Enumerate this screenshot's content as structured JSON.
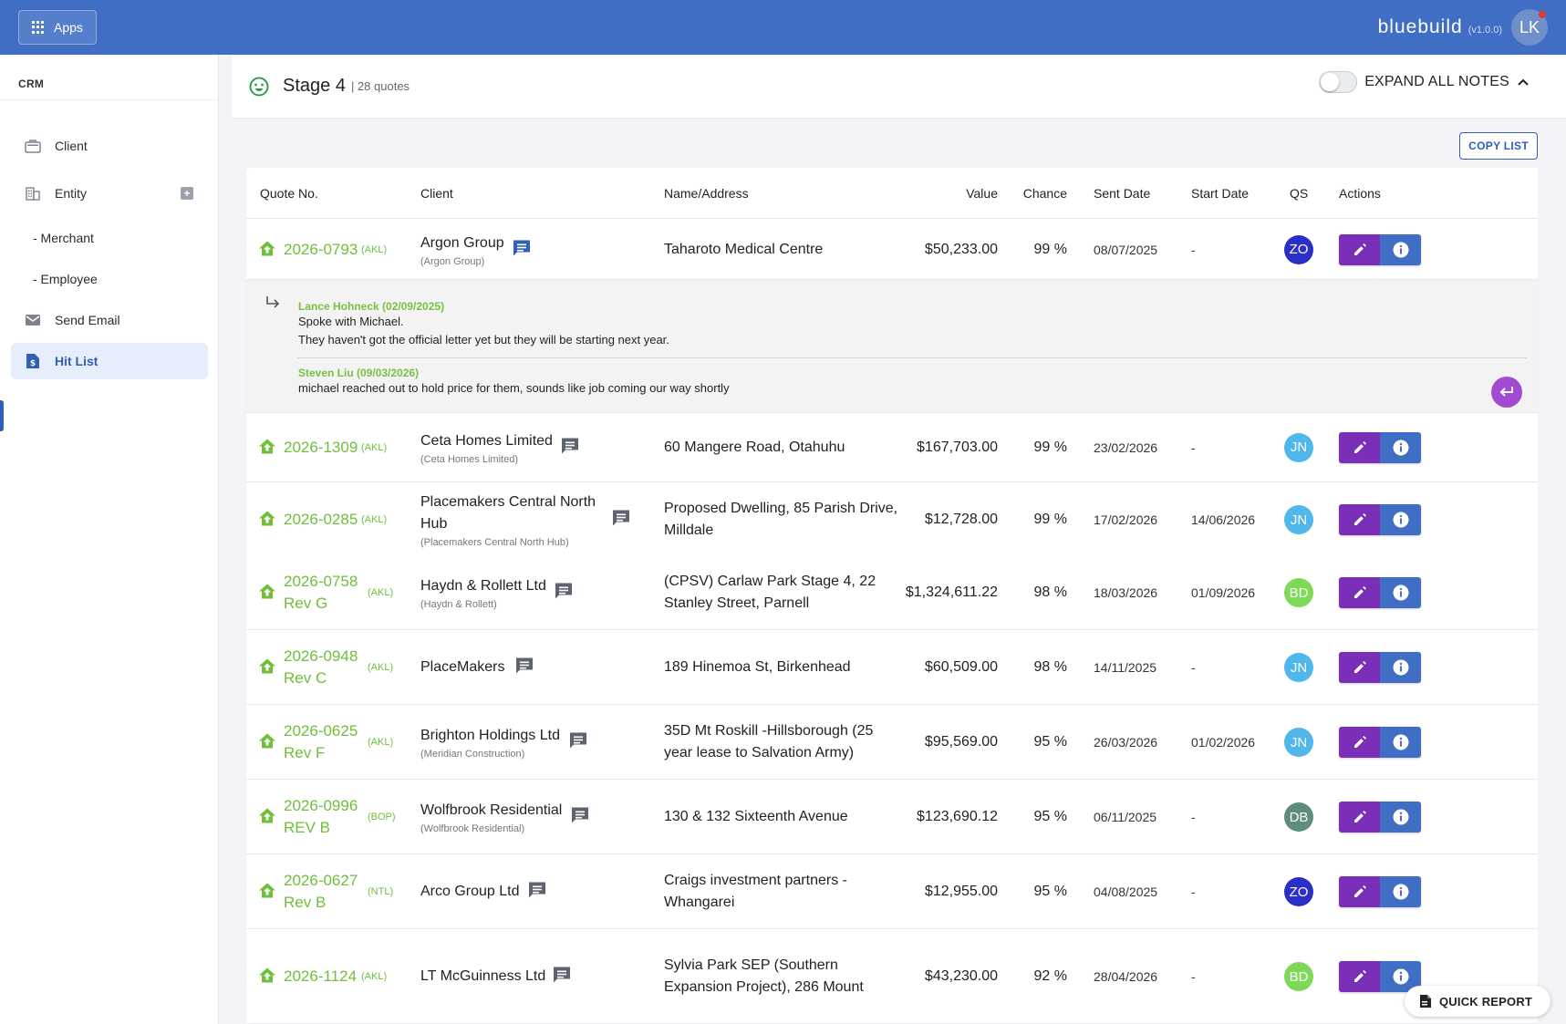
{
  "topbar": {
    "apps_label": "Apps",
    "brand": "bluebuild",
    "version": "(v1.0.0)",
    "user_initials": "LK"
  },
  "sidebar": {
    "section": "CRM",
    "items": [
      {
        "label": "Client",
        "icon": "briefcase-icon"
      },
      {
        "label": "Entity",
        "icon": "building-icon"
      },
      {
        "label": "- Merchant"
      },
      {
        "label": "- Employee"
      },
      {
        "label": "Send Email",
        "icon": "mail-icon"
      },
      {
        "label": "Hit List",
        "icon": "document-dollar-icon",
        "active": true
      }
    ]
  },
  "stage": {
    "title": "Stage 4",
    "count": "| 28 quotes",
    "expand_label": "EXPAND ALL NOTES",
    "expand_on": false,
    "copy_label": "COPY LIST"
  },
  "table": {
    "headers": {
      "quote": "Quote No.",
      "client": "Client",
      "name": "Name/Address",
      "value": "Value",
      "chance": "Chance",
      "sent": "Sent Date",
      "start": "Start Date",
      "qs": "QS",
      "actions": "Actions"
    },
    "rows": [
      {
        "quote": "2026-0793",
        "quote2": "",
        "region": "(AKL)",
        "client": "Argon Group",
        "client2": "",
        "client_sub": "(Argon Group)",
        "name": "Taharoto Medical Centre",
        "name2": "",
        "value": "$50,233.00",
        "chance": "99 %",
        "sent": "08/07/2025",
        "start": "-",
        "qs": "ZO",
        "qs_color": "#2a2fc8"
      },
      {
        "quote": "2026-1309",
        "quote2": "",
        "region": "(AKL)",
        "client": "Ceta Homes Limited",
        "client2": "",
        "client_sub": "(Ceta Homes Limited)",
        "name": "60 Mangere Road, Otahuhu",
        "name2": "",
        "value": "$167,703.00",
        "chance": "99 %",
        "sent": "23/02/2026",
        "start": "-",
        "qs": "JN",
        "qs_color": "#4fb7ea"
      },
      {
        "quote": "2026-0285",
        "quote2": "",
        "region": "(AKL)",
        "client": "Placemakers Central North",
        "client2": "Hub",
        "client_sub": "(Placemakers Central North Hub)",
        "name": "Proposed Dwelling, 85 Parish Drive,",
        "name2": "Milldale",
        "value": "$12,728.00",
        "chance": "99 %",
        "sent": "17/02/2026",
        "start": "14/06/2026",
        "qs": "JN",
        "qs_color": "#4fb7ea"
      },
      {
        "quote": "2026-0758",
        "quote2": "Rev G",
        "region": "(AKL)",
        "client": "Haydn & Rollett Ltd",
        "client2": "",
        "client_sub": "(Haydn & Rollett)",
        "name": "(CPSV) Carlaw Park Stage 4, 22",
        "name2": "Stanley Street, Parnell",
        "value": "$1,324,611.22",
        "chance": "98 %",
        "sent": "18/03/2026",
        "start": "01/09/2026",
        "qs": "BD",
        "qs_color": "#7ed957"
      },
      {
        "quote": "2026-0948",
        "quote2": "Rev C",
        "region": "(AKL)",
        "client": "PlaceMakers",
        "client2": "",
        "client_sub": "",
        "name": "189 Hinemoa St, Birkenhead",
        "name2": "",
        "value": "$60,509.00",
        "chance": "98 %",
        "sent": "14/11/2025",
        "start": "-",
        "qs": "JN",
        "qs_color": "#4fb7ea"
      },
      {
        "quote": "2026-0625",
        "quote2": "Rev F",
        "region": "(AKL)",
        "client": "Brighton Holdings Ltd",
        "client2": "",
        "client_sub": "(Meridian Construction)",
        "name": "35D Mt Roskill -Hillsborough (25",
        "name2": "year lease to Salvation Army)",
        "value": "$95,569.00",
        "chance": "95 %",
        "sent": "26/03/2026",
        "start": "01/02/2026",
        "qs": "JN",
        "qs_color": "#4fb7ea"
      },
      {
        "quote": "2026-0996",
        "quote2": "REV B",
        "region": "(BOP)",
        "client": "Wolfbrook Residential",
        "client2": "",
        "client_sub": "(Wolfbrook Residential)",
        "name": "130 & 132 Sixteenth Avenue",
        "name2": "",
        "value": "$123,690.12",
        "chance": "95 %",
        "sent": "06/11/2025",
        "start": "-",
        "qs": "DB",
        "qs_color": "#5e8c7e"
      },
      {
        "quote": "2026-0627",
        "quote2": "Rev B",
        "region": "(NTL)",
        "client": "Arco Group Ltd",
        "client2": "",
        "client_sub": "",
        "name": "Craigs investment partners -",
        "name2": "Whangarei",
        "value": "$12,955.00",
        "chance": "95 %",
        "sent": "04/08/2025",
        "start": "-",
        "qs": "ZO",
        "qs_color": "#2a2fc8"
      },
      {
        "quote": "2026-1124",
        "quote2": "",
        "region": "(AKL)",
        "client": "LT McGuinness Ltd",
        "client2": "",
        "client_sub": "",
        "name": "Sylvia Park SEP (Southern",
        "name2": "Expansion Project), 286 Mount",
        "value": "$43,230.00",
        "chance": "92 %",
        "sent": "28/04/2026",
        "start": "-",
        "qs": "BD",
        "qs_color": "#7ed957"
      }
    ],
    "notes": [
      {
        "author": "Lance Hohneck (02/09/2025)",
        "lines": [
          "Spoke with Michael.",
          "They haven't got the official letter yet but they will be starting next year."
        ]
      },
      {
        "author": "Steven Liu (09/03/2026)",
        "lines": [
          "michael reached out to hold price for them, sounds like job coming our way shortly"
        ]
      }
    ]
  },
  "quick_report_label": "QUICK REPORT"
}
